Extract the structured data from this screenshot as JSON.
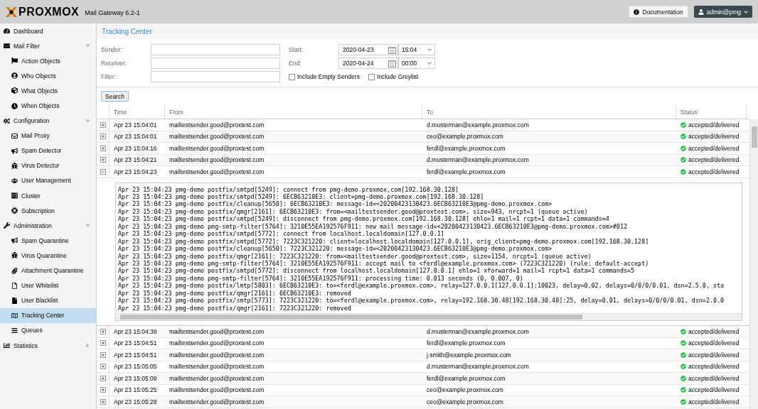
{
  "header": {
    "logo": "PROXMOX",
    "product": "Mail Gateway 6.2-1",
    "documentation": "Documentation",
    "user": "admin@pmg"
  },
  "sidebar": {
    "items": [
      {
        "label": "Dashboard",
        "selected": false
      },
      {
        "label": "Mail Filter",
        "selected": false,
        "expanded": true,
        "children": [
          {
            "label": "Action Objects",
            "selected": false
          },
          {
            "label": "Who Objects",
            "selected": false
          },
          {
            "label": "What Objects",
            "selected": false
          },
          {
            "label": "When Objects",
            "selected": false
          }
        ]
      },
      {
        "label": "Configuration",
        "selected": false,
        "expanded": true,
        "children": [
          {
            "label": "Mail Proxy",
            "selected": false
          },
          {
            "label": "Spam Detector",
            "selected": false
          },
          {
            "label": "Virus Detector",
            "selected": false
          },
          {
            "label": "User Management",
            "selected": false
          },
          {
            "label": "Cluster",
            "selected": false
          },
          {
            "label": "Subscription",
            "selected": false
          }
        ]
      },
      {
        "label": "Administration",
        "selected": false,
        "expanded": true,
        "children": [
          {
            "label": "Spam Quarantine",
            "selected": false
          },
          {
            "label": "Virus Quarantine",
            "selected": false
          },
          {
            "label": "Attachment Quarantine",
            "selected": false
          },
          {
            "label": "User Whitelist",
            "selected": false
          },
          {
            "label": "User Blacklist",
            "selected": false
          },
          {
            "label": "Tracking Center",
            "selected": true
          },
          {
            "label": "Queues",
            "selected": false
          }
        ]
      },
      {
        "label": "Statistics",
        "selected": false,
        "expanded": false
      }
    ]
  },
  "panel": {
    "title": "Tracking Center",
    "form": {
      "sender": {
        "label": "Sender:"
      },
      "receiver": {
        "label": "Receiver:"
      },
      "filter": {
        "label": "Filter:"
      },
      "start": {
        "label": "Start:",
        "date": "2020-04-23",
        "time": "15:04"
      },
      "end": {
        "label": "End:",
        "date": "2020-04-24",
        "time": "00:00"
      },
      "checkboxes": [
        {
          "label": "Include Empty Senders",
          "checked": false
        },
        {
          "label": "Include Greylist",
          "checked": false
        }
      ]
    },
    "search_button": "Search",
    "table": {
      "columns": [
        "Time",
        "From",
        "To",
        "Status"
      ],
      "rows": [
        {
          "time": "Apr 23 15:04:01",
          "from": "mailtestsender.good@proxtest.com",
          "to": "d.musterman@example.proxmox.com",
          "status": "accepted/delivered",
          "expanded": false
        },
        {
          "time": "Apr 23 15:04:01",
          "from": "mailtestsender.good@proxtest.com",
          "to": "ceo@example.proxmox.com",
          "status": "accepted/delivered",
          "expanded": false
        },
        {
          "time": "Apr 23 15:04:16",
          "from": "mailtestsender.good@proxtest.com",
          "to": "ferdl@example.proxmox.com",
          "status": "accepted/delivered",
          "expanded": false
        },
        {
          "time": "Apr 23 15:04:21",
          "from": "mailtestsender.good@proxtest.com",
          "to": "d.musterman@example.proxmox.com",
          "status": "accepted/delivered",
          "expanded": false
        },
        {
          "time": "Apr 23 15:04:23",
          "from": "mailtestsender.good@proxtest.com",
          "to": "ferdl@example.proxmox.com",
          "status": "accepted/delivered",
          "expanded": true,
          "log": [
            "Apr 23 15:04:23 pmg-demo postfix/smtpd[5249]: connect from pmg-demo.proxmox.com[192.168.30.128]",
            "Apr 23 15:04:23 pmg-demo postfix/smtpd[5249]: 6ECB63210E3: client=pmg-demo.proxmox.com[192.168.30.128]",
            "Apr 23 15:04:23 pmg-demo postfix/cleanup[5650]: 6ECB63210E3: message-id=<20200423130423.6ECB63210E3@pmg-demo.proxmox.com>",
            "Apr 23 15:04:23 pmg-demo postfix/qmgr[2161]: 6ECB63210E3: from=<mailtestsender.good@proxtest.com>, size=943, nrcpt=1 (queue active)",
            "Apr 23 15:04:23 pmg-demo postfix/smtpd[5249]: disconnect from pmg-demo.proxmox.com[192.168.30.128] ehlo=1 mail=1 rcpt=1 data=1 commands=4",
            "Apr 23 15:04:23 pmg-demo pmg-smtp-filter[5764]: 3210E55EA192576F911: new mail message-id=<20200423130423.6ECB63210E3@pmg-demo.proxmox.com>#012",
            "Apr 23 15:04:23 pmg-demo postfix/smtpd[5772]: connect from localhost.localdomain[127.0.0.1]",
            "Apr 23 15:04:23 pmg-demo postfix/smtpd[5772]: 7223C321220: client=localhost.localdomain[127.0.0.1], orig_client=pmg-demo.proxmox.com[192.168.30.128]",
            "Apr 23 15:04:23 pmg-demo postfix/cleanup[5650]: 7223C321220: message-id=<20200423130423.6ECB63210E3@pmg-demo.proxmox.com>",
            "Apr 23 15:04:23 pmg-demo postfix/qmgr[2161]: 7223C321220: from=<mailtestsender.good@proxtest.com>, size=1154, nrcpt=1 (queue active)",
            "Apr 23 15:04:23 pmg-demo pmg-smtp-filter[5764]: 3210E55EA192576F911: accept mail to <ferdl@example.proxmox.com> (7223C321220) (rule: default-accept)",
            "Apr 23 15:04:23 pmg-demo postfix/smtpd[5772]: disconnect from localhost.localdomain[127.0.0.1] ehlo=1 xforward=1 mail=1 rcpt=1 data=1 commands=5",
            "Apr 23 15:04:23 pmg-demo pmg-smtp-filter[5764]: 3210E55EA192576F911: processing time: 0.013 seconds (0, 0.007, 0)",
            "Apr 23 15:04:23 pmg-demo postfix/lmtp[5803]: 6ECB63210E3: to=<ferdl@example.proxmox.com>, relay=127.0.0.1[127.0.0.1]:10023, delay=0.02, delays=0/0/0/0.01, dsn=2.5.0, sta",
            "Apr 23 15:04:23 pmg-demo postfix/qmgr[2161]: 6ECB63210E3: removed",
            "Apr 23 15:04:23 pmg-demo postfix/smtp[5773]: 7223C321220: to=<ferdl@example.proxmox.com>, relay=192.168.30.48[192.168.30.48]:25, delay=0.01, delays=0/0/0/0.01, dsn=2.0.0",
            "Apr 23 15:04:23 pmg-demo postfix/qmgr[2161]: 7223C321220: removed"
          ]
        },
        {
          "time": "Apr 23 15:04:39",
          "from": "mailtestsender.good@proxtest.com",
          "to": "d.musterman@example.proxmox.com",
          "status": "accepted/delivered",
          "expanded": false
        },
        {
          "time": "Apr 23 15:04:51",
          "from": "mailtestsender.good@proxtest.com",
          "to": "ferdl@example.proxmox.com",
          "status": "accepted/delivered",
          "expanded": false
        },
        {
          "time": "Apr 23 15:04:51",
          "from": "mailtestsender.good@proxtest.com",
          "to": "j.smith@example.proxmox.com",
          "status": "accepted/delivered",
          "expanded": false
        },
        {
          "time": "Apr 23 15:05:05",
          "from": "mailtestsender.good@proxtest.com",
          "to": "d.musterman@example.proxmox.com",
          "status": "accepted/delivered",
          "expanded": false
        },
        {
          "time": "Apr 23 15:05:09",
          "from": "mailtestsender.good@proxtest.com",
          "to": "ferdl@example.proxmox.com",
          "status": "accepted/delivered",
          "expanded": false
        },
        {
          "time": "Apr 23 15:05:25",
          "from": "mailtestsender.good@proxtest.com",
          "to": "ceo@example.proxmox.com",
          "status": "accepted/delivered",
          "expanded": false
        },
        {
          "time": "Apr 23 15:05:28",
          "from": "mailtestsender.good@proxtest.com",
          "to": "ceo@example.proxmox.com",
          "status": "accepted/delivered",
          "expanded": false
        }
      ]
    }
  }
}
